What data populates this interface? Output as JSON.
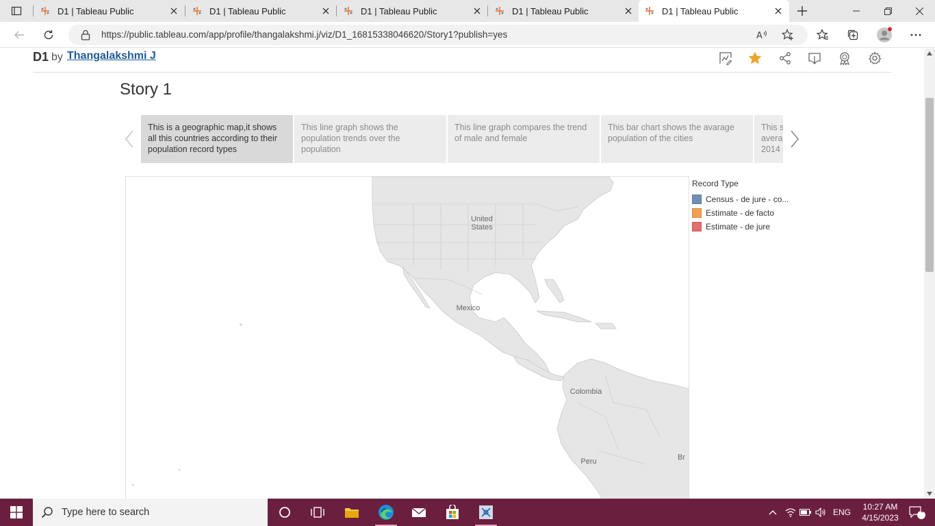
{
  "browser": {
    "tabs": [
      {
        "title": "D1 | Tableau Public",
        "active": false
      },
      {
        "title": "D1 | Tableau Public",
        "active": false
      },
      {
        "title": "D1 | Tableau Public",
        "active": false
      },
      {
        "title": "D1 | Tableau Public",
        "active": false
      },
      {
        "title": "D1 | Tableau Public",
        "active": true
      }
    ],
    "url": "https://public.tableau.com/app/profile/thangalakshmi.j/viz/D1_16815338046620/Story1?publish=yes"
  },
  "viz": {
    "title": "D1",
    "by": "by",
    "author": "Thangalakshmi J",
    "favorite_color": "#f0a02a"
  },
  "story": {
    "title": "Story 1",
    "points": [
      "This is a geographic map,it shows all this countries according to their population record types",
      "This line graph shows the population trends over the population",
      "This line graph compares the trend of male and female",
      "This bar chart shows the avarage population of the cities",
      "This s avera 2014"
    ],
    "active_index": 0
  },
  "map": {
    "labels": {
      "us": "United States",
      "mexico": "Mexico",
      "colombia": "Colombia",
      "peru": "Peru",
      "brazil": "Br"
    }
  },
  "legend": {
    "title": "Record Type",
    "items": [
      {
        "label": "Census - de jure - co...",
        "color": "#6f8fb5"
      },
      {
        "label": "Estimate - de facto",
        "color": "#f2a04f"
      },
      {
        "label": "Estimate - de jure",
        "color": "#e46f6f"
      }
    ]
  },
  "taskbar": {
    "search_placeholder": "Type here to search",
    "language": "ENG",
    "time": "10:27 AM",
    "date": "4/15/2023",
    "notification_count": "3",
    "accent": "#6b1f3f"
  }
}
